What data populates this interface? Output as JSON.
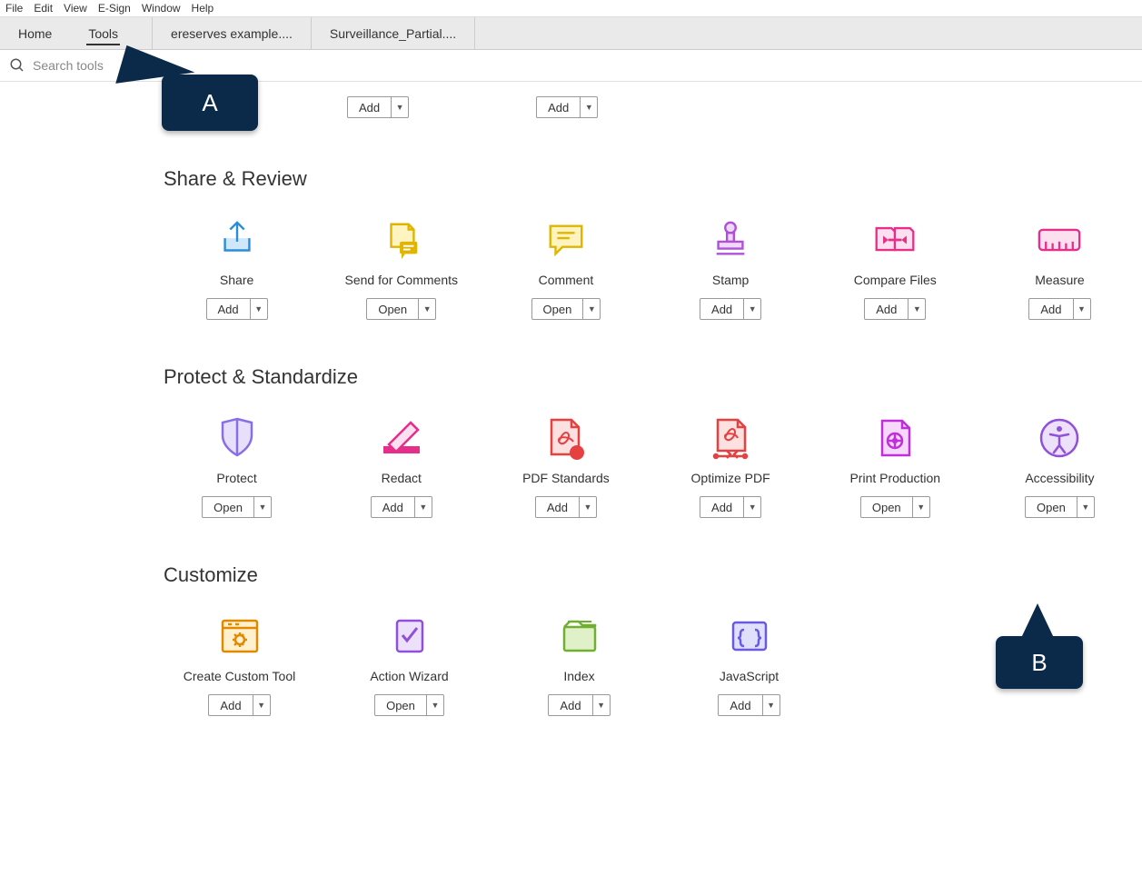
{
  "menu": [
    "File",
    "Edit",
    "View",
    "E-Sign",
    "Window",
    "Help"
  ],
  "tabs": {
    "home": "Home",
    "tools": "Tools",
    "docs": [
      "ereserves example....",
      "Surveillance_Partial...."
    ]
  },
  "search": {
    "placeholder": "Search tools"
  },
  "buttons": {
    "add": "Add",
    "open": "Open"
  },
  "topRow": [
    {
      "action": "add"
    },
    {
      "action": "add"
    }
  ],
  "sections": [
    {
      "title": "Share & Review",
      "tools": [
        {
          "label": "Share",
          "action": "add",
          "icon": "share"
        },
        {
          "label": "Send for Comments",
          "action": "open",
          "icon": "send-comments"
        },
        {
          "label": "Comment",
          "action": "open",
          "icon": "comment"
        },
        {
          "label": "Stamp",
          "action": "add",
          "icon": "stamp"
        },
        {
          "label": "Compare Files",
          "action": "add",
          "icon": "compare"
        },
        {
          "label": "Measure",
          "action": "add",
          "icon": "measure"
        }
      ]
    },
    {
      "title": "Protect & Standardize",
      "tools": [
        {
          "label": "Protect",
          "action": "open",
          "icon": "protect"
        },
        {
          "label": "Redact",
          "action": "add",
          "icon": "redact"
        },
        {
          "label": "PDF Standards",
          "action": "add",
          "icon": "pdf-standards"
        },
        {
          "label": "Optimize PDF",
          "action": "add",
          "icon": "optimize"
        },
        {
          "label": "Print Production",
          "action": "open",
          "icon": "print-production"
        },
        {
          "label": "Accessibility",
          "action": "open",
          "icon": "accessibility"
        }
      ]
    },
    {
      "title": "Customize",
      "tools": [
        {
          "label": "Create Custom Tool",
          "action": "add",
          "icon": "custom-tool"
        },
        {
          "label": "Action Wizard",
          "action": "open",
          "icon": "action-wizard"
        },
        {
          "label": "Index",
          "action": "add",
          "icon": "index"
        },
        {
          "label": "JavaScript",
          "action": "add",
          "icon": "javascript"
        }
      ]
    }
  ],
  "callouts": {
    "a": "A",
    "b": "B"
  }
}
